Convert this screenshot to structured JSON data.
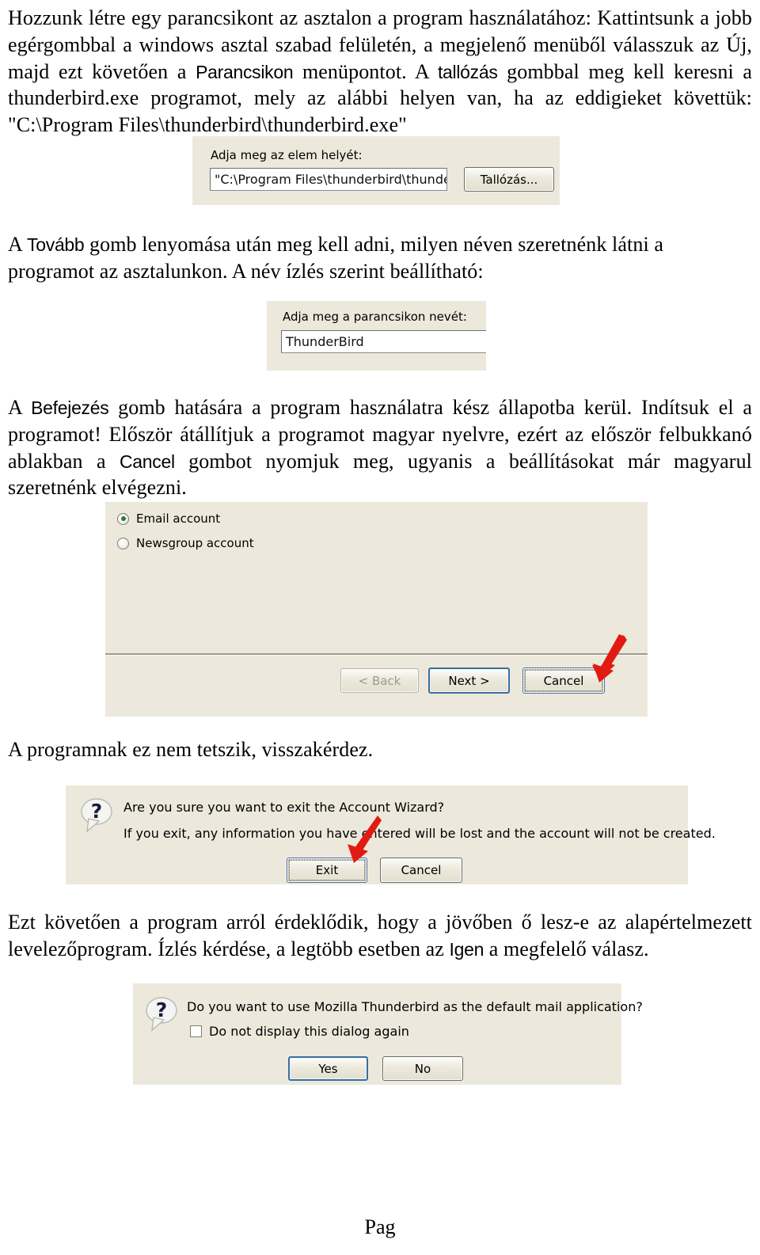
{
  "document": {
    "paragraphs": {
      "intro": "Hozzunk létre egy parancsikont az asztalon a program használatához: Kattintsunk a jobb egérgombbal a windows asztal szabad felületén, a megjelenő menüből válasszuk az Új, majd ezt követően a ",
      "intro_term1": "Parancsikon",
      "intro_mid": " menüpontot. A ",
      "intro_term2": "tallózás",
      "intro_end": " gombbal meg kell keresni a thunderbird.exe programot, mely az alábbi helyen van, ha az eddigieket követtük: \"C:\\Program Files\\thunderbird\\thunderbird.exe\"",
      "after_first_a": "A ",
      "after_first_term": "Tovább",
      "after_first_b": " gomb lenyomása után meg kell adni, milyen néven szeretnénk látni a programot az asztalunkon. A név ízlés szerint beállítható:",
      "after_second_a": "A ",
      "after_second_term1": "Befejezés",
      "after_second_b": " gomb hatására a program használatra kész állapotba kerül. Indítsuk el a programot! Először átállítjuk a programot magyar nyelvre, ezért az először felbukkanó ablakban a ",
      "after_second_term2": "Cancel",
      "after_second_c": " gombot nyomjuk meg, ugyanis a beállításokat már magyarul szeretnénk elvégezni.",
      "after_wizard": "A programnak ez nem tetszik, visszakérdez.",
      "after_exit_a": "Ezt követően a program arról érdeklődik, hogy a jövőben ő lesz-e az alapértelmezett levelezőprogram. Ízlés kérdése, a legtöbb esetben az ",
      "after_exit_term": "Igen",
      "after_exit_b": " a megfelelő válasz."
    },
    "footer": "Pag"
  },
  "screenshot_location": {
    "label": "Adja meg az elem helyét:",
    "path_value": "\"C:\\Program Files\\thunderbird\\thundert",
    "browse_button": "Tallózás..."
  },
  "screenshot_shortcut_name": {
    "label": "Adja meg a parancsikon nevét:",
    "name_value": "ThunderBird"
  },
  "screenshot_account_wizard": {
    "options": [
      {
        "label": "Email account",
        "selected": true
      },
      {
        "label": "Newsgroup account",
        "selected": false
      }
    ],
    "buttons": [
      {
        "label": "< Back",
        "state": "disabled"
      },
      {
        "label": "Next >",
        "state": "default"
      },
      {
        "label": "Cancel",
        "state": "focus"
      }
    ]
  },
  "screenshot_exit_confirm": {
    "icon": "question-icon",
    "line1": "Are you sure you want to exit the Account Wizard?",
    "line2": "If you exit, any information you have entered will be lost and the account will not be created.",
    "buttons": [
      {
        "label": "Exit",
        "state": "focus"
      },
      {
        "label": "Cancel",
        "state": "normal"
      }
    ]
  },
  "screenshot_default_mail": {
    "icon": "question-icon",
    "question": "Do you want to use Mozilla Thunderbird as the default mail application?",
    "checkbox_label": "Do not display this dialog again",
    "checkbox_checked": false,
    "buttons": [
      {
        "label": "Yes",
        "state": "default"
      },
      {
        "label": "No",
        "state": "normal"
      }
    ]
  },
  "colors": {
    "dialog_face": "#ece9dc",
    "arrow_red": "#e21b12",
    "radio_dot_green": "#2e7d32",
    "default_button_border": "#3a6ea5"
  }
}
